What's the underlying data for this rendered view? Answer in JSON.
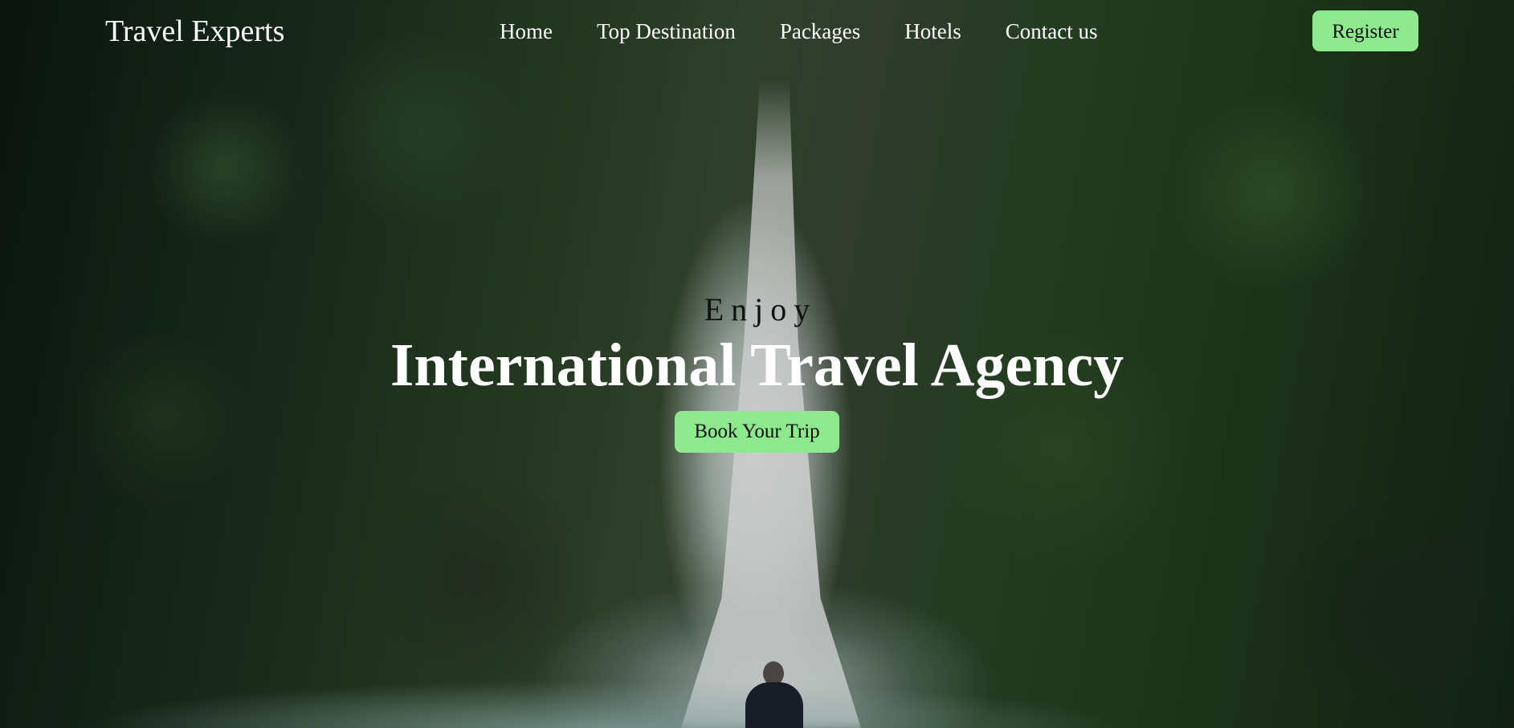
{
  "header": {
    "brand": "Travel Experts",
    "nav": [
      {
        "label": "Home"
      },
      {
        "label": "Top Destination"
      },
      {
        "label": "Packages"
      },
      {
        "label": "Hotels"
      },
      {
        "label": "Contact us"
      }
    ],
    "register_label": "Register"
  },
  "hero": {
    "eyebrow": "Enjoy",
    "headline": "International Travel Agency",
    "cta_label": "Book Your Trip",
    "background": "waterfall-jungle-photo"
  },
  "colors": {
    "accent": "#8ee88e",
    "text_light": "#ffffff",
    "text_dark": "#111111"
  }
}
